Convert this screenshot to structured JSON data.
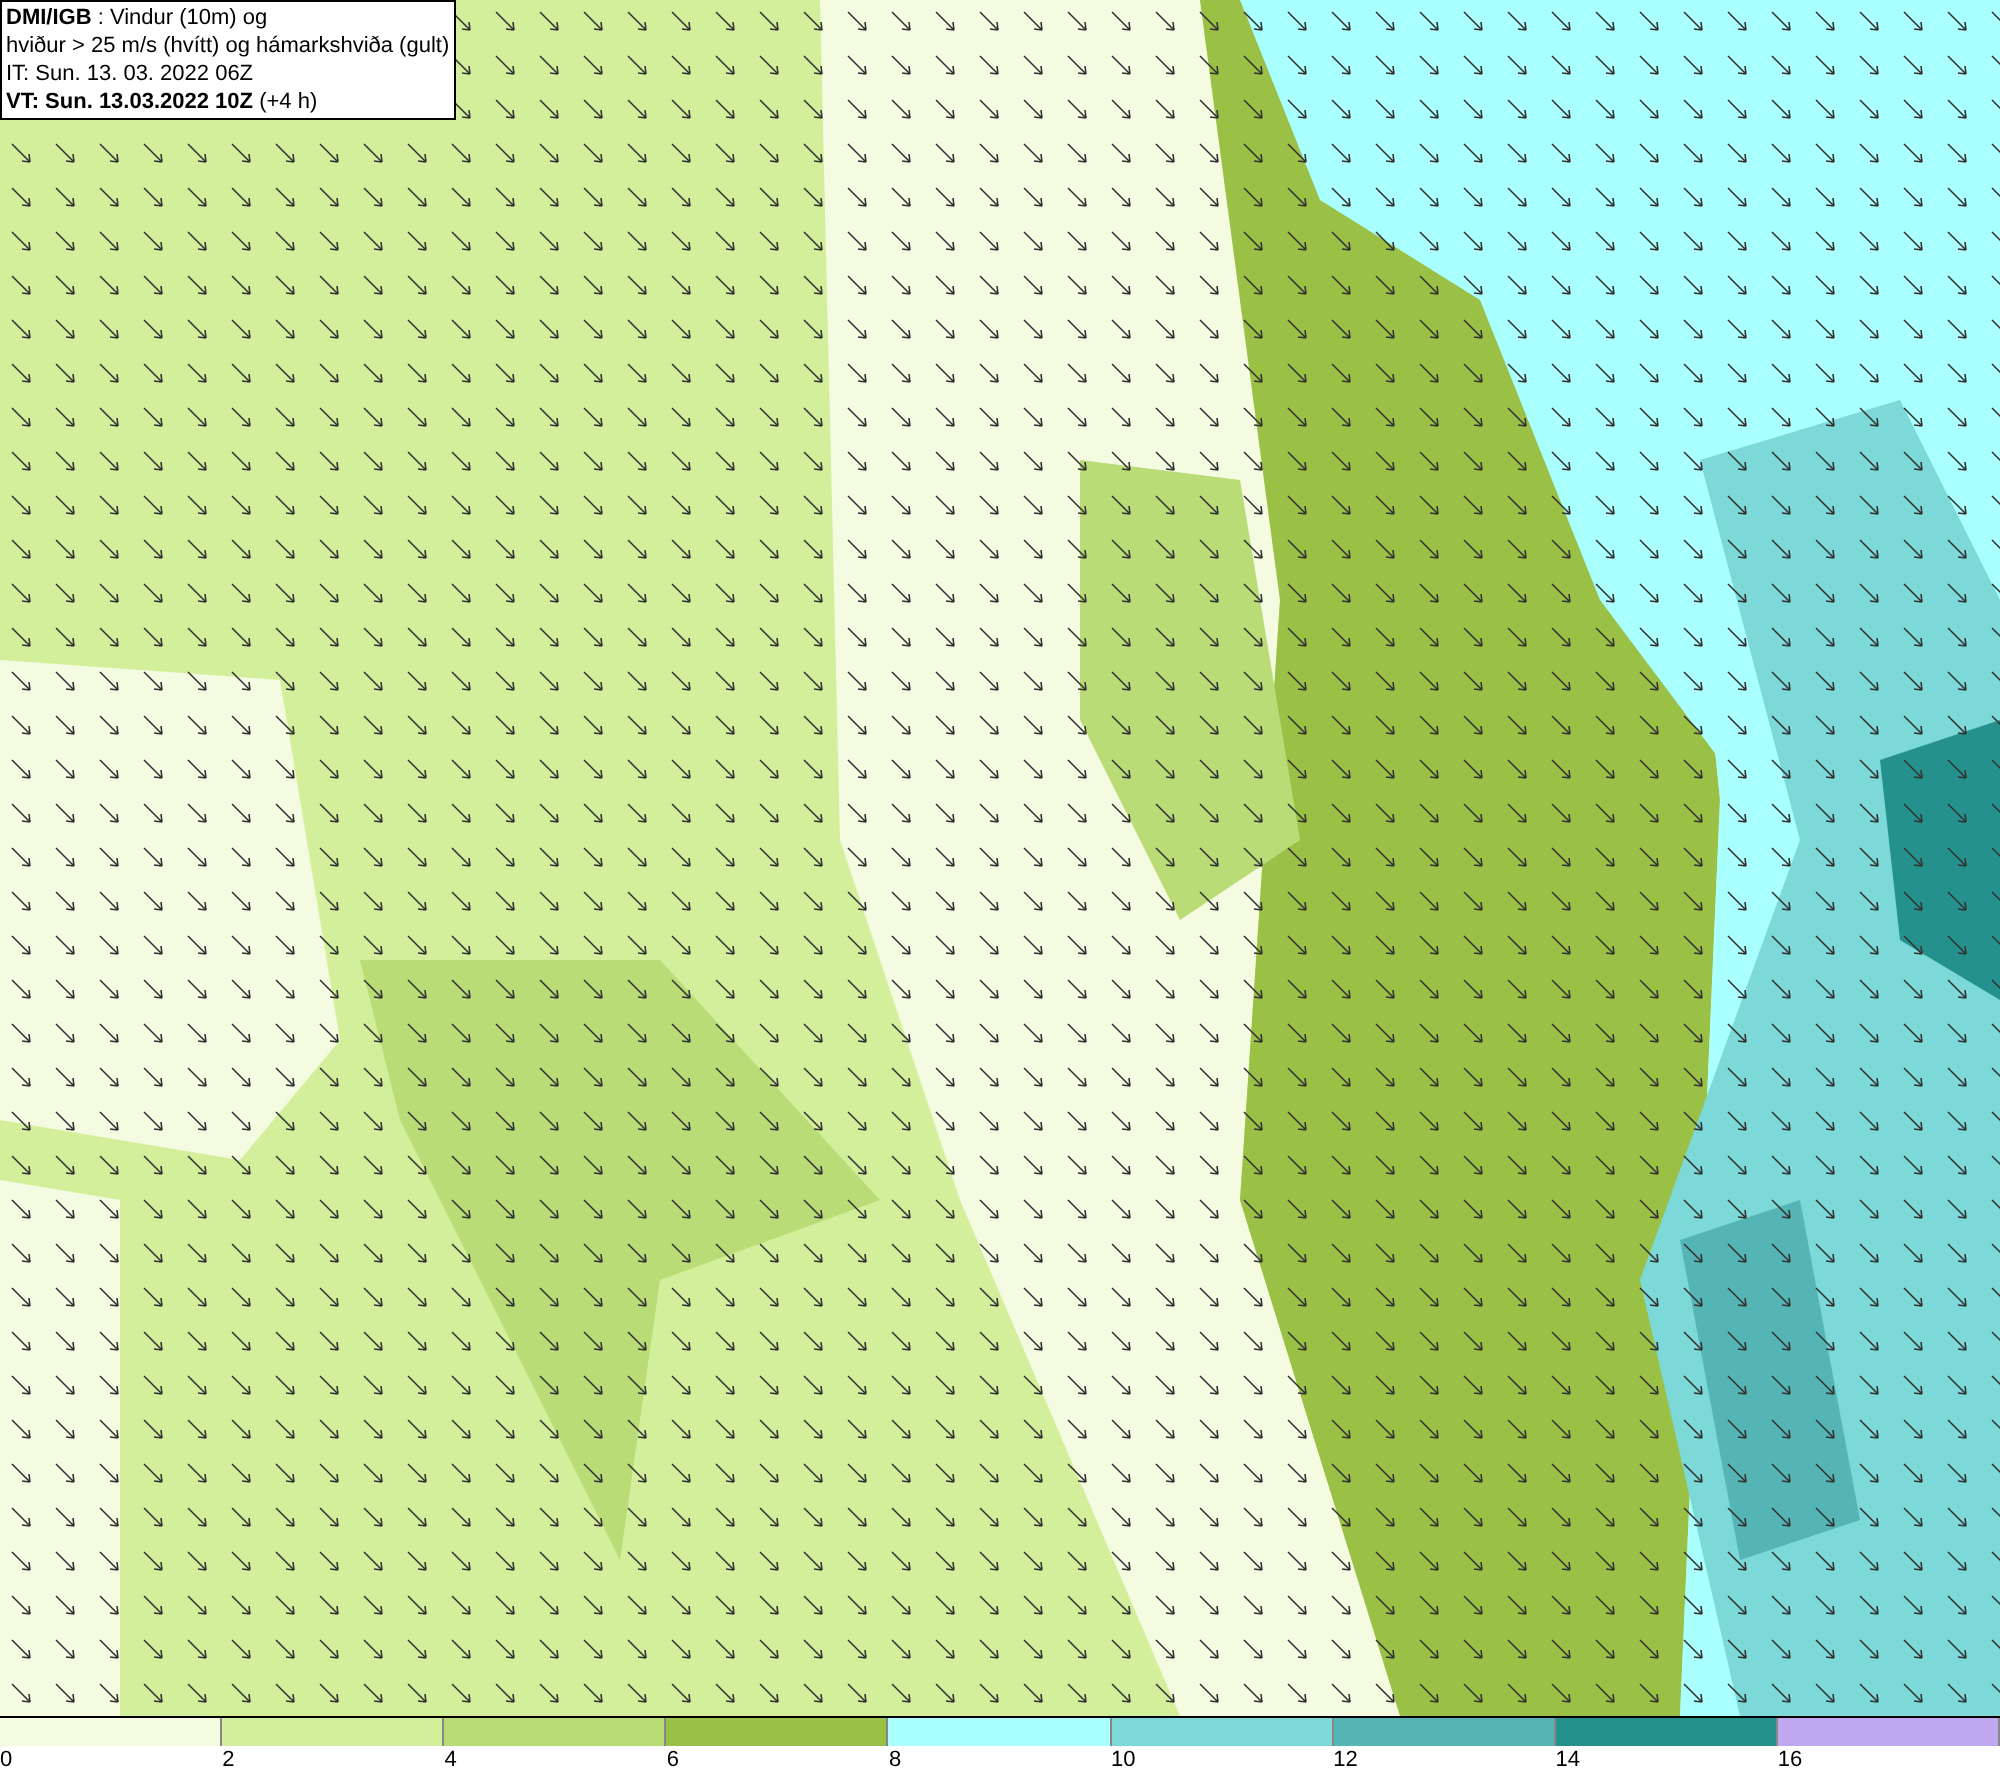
{
  "info_box": {
    "lines": [
      "**DMI/IGB** : Vindur (10m) og",
      "hviður > 25 m/s (hvítt) og hámarkshviða (gult)",
      "IT: Sun. 13. 03. 2022 06Z",
      "**VT: Sun. 13.03.2022 10Z** (+4 h)"
    ]
  },
  "legend": {
    "segments": [
      {
        "color": "#f4fbe0",
        "label": "0"
      },
      {
        "color": "#d4ef9c",
        "label": "2"
      },
      {
        "color": "#b9dc77",
        "label": "4"
      },
      {
        "color": "#9bc046",
        "label": "6"
      },
      {
        "color": "#aaffff",
        "label": "8"
      },
      {
        "color": "#7dd8d8",
        "label": "10"
      },
      {
        "color": "#55b4b4",
        "label": "12"
      },
      {
        "color": "#24918c",
        "label": "14"
      },
      {
        "color": "#c0a8f0",
        "label": "16"
      }
    ]
  }
}
